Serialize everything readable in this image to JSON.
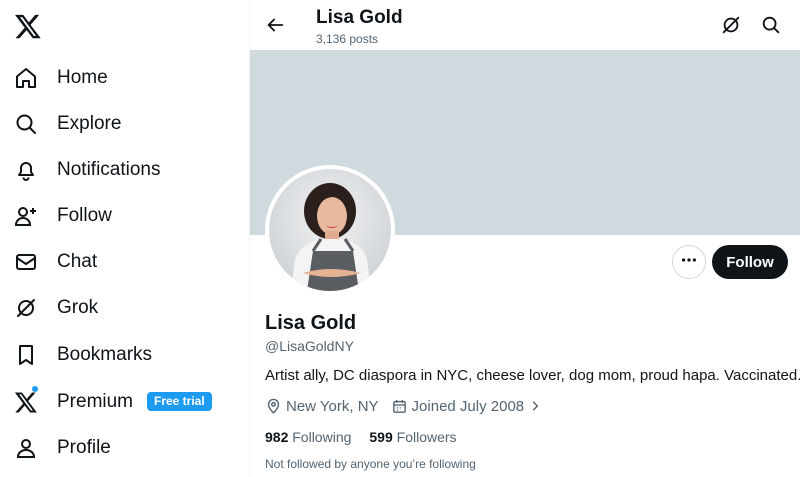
{
  "sidebar": {
    "logo": "x-logo-icon",
    "items": [
      {
        "label": "Home",
        "icon": "home-icon"
      },
      {
        "label": "Explore",
        "icon": "search-icon"
      },
      {
        "label": "Notifications",
        "icon": "bell-icon"
      },
      {
        "label": "Follow",
        "icon": "add-user-icon"
      },
      {
        "label": "Chat",
        "icon": "mail-icon"
      },
      {
        "label": "Grok",
        "icon": "grok-icon"
      },
      {
        "label": "Bookmarks",
        "icon": "bookmark-icon"
      },
      {
        "label": "Premium",
        "icon": "x-icon",
        "badge": "Free trial"
      },
      {
        "label": "Profile",
        "icon": "person-icon"
      }
    ]
  },
  "header": {
    "title": "Lisa Gold",
    "posts": "3,136 posts"
  },
  "profile": {
    "name": "Lisa Gold",
    "handle": "@LisaGoldNY",
    "bio": "Artist ally, DC diaspora in NYC, cheese lover, dog mom, proud hapa. Vaccinated.",
    "location": "New York, NY",
    "joined": "Joined July 2008",
    "following_count": "982",
    "following_label": "Following",
    "followers_count": "599",
    "followers_label": "Followers",
    "followed_note": "Not followed by anyone you’re following",
    "follow_button": "Follow"
  },
  "colors": {
    "accent": "#1d9bf0",
    "text": "#0f1419",
    "muted": "#536471",
    "banner": "#cfd9de"
  }
}
